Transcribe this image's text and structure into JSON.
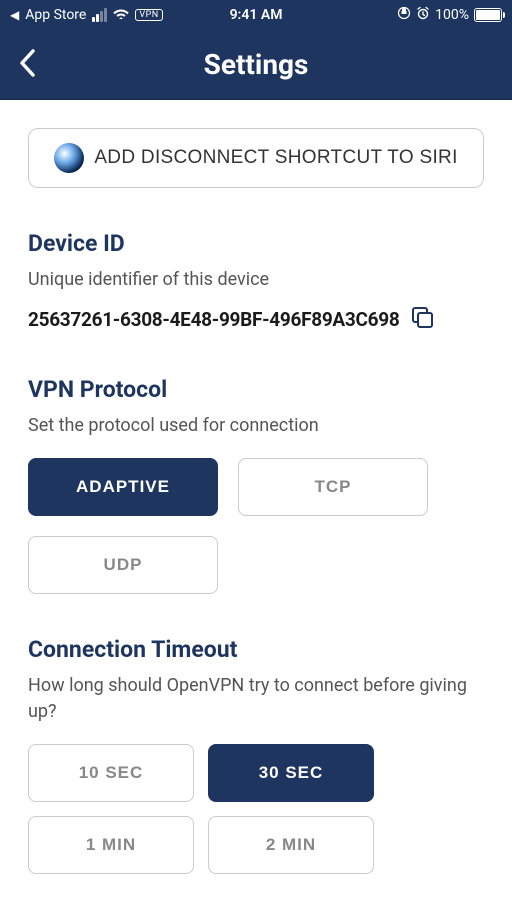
{
  "statusbar": {
    "back_app": "App Store",
    "time": "9:41 AM",
    "vpn_label": "VPN",
    "battery_pct": "100%"
  },
  "header": {
    "title": "Settings"
  },
  "siri": {
    "label": "ADD DISCONNECT SHORTCUT TO SIRI"
  },
  "device": {
    "heading": "Device ID",
    "desc": "Unique identifier of this device",
    "value": "25637261-6308-4E48-99BF-496F89A3C698"
  },
  "protocol": {
    "heading": "VPN Protocol",
    "desc": "Set the protocol used for connection",
    "options": [
      "ADAPTIVE",
      "TCP",
      "UDP"
    ],
    "selected": 0
  },
  "timeout": {
    "heading": "Connection Timeout",
    "desc": "How long should OpenVPN try to connect before giving up?",
    "options": [
      "10 SEC",
      "30 SEC",
      "1 MIN",
      "2 MIN"
    ],
    "selected": 1
  }
}
